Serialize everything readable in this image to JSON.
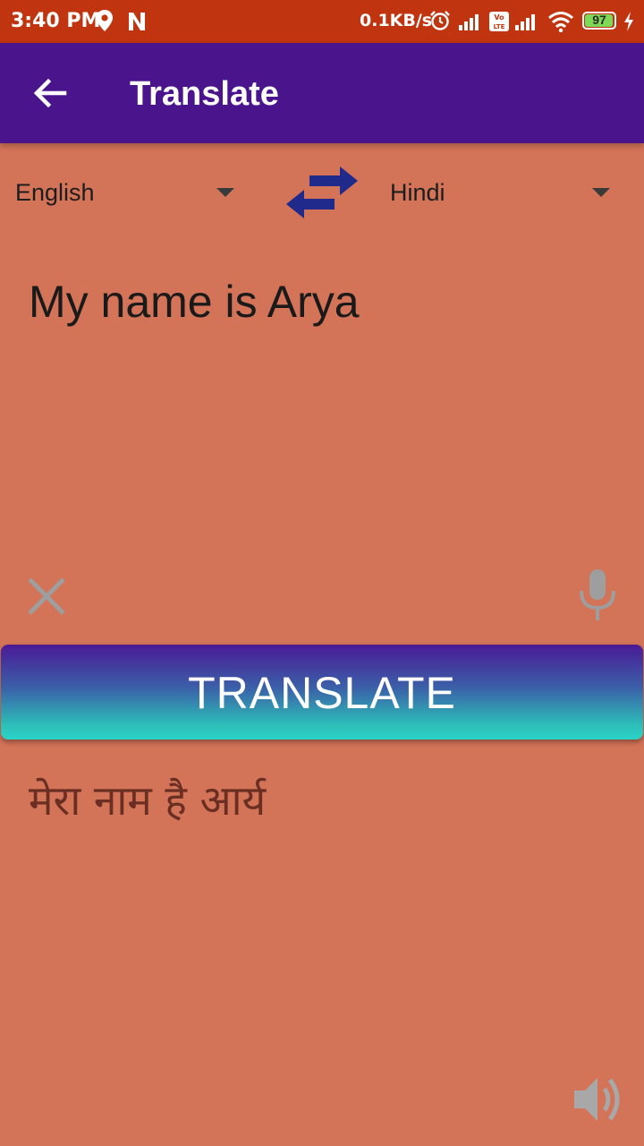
{
  "status_bar": {
    "time": "3:40 PM",
    "network_speed": "0.1KB/s",
    "battery_level": "97",
    "battery_fraction": 0.97,
    "icons": [
      "location-icon",
      "notification-n-icon",
      "alarm-icon",
      "signal-icon",
      "volte-icon",
      "signal-icon",
      "wifi-icon",
      "battery-icon",
      "charging-icon"
    ]
  },
  "app_bar": {
    "title": "Translate",
    "back_icon": "arrow-back-icon"
  },
  "languages": {
    "source": "English",
    "target": "Hindi",
    "swap_icon": "swap-arrows-icon"
  },
  "input": {
    "text": "My name is Arya",
    "clear_icon": "close-icon",
    "mic_icon": "microphone-icon"
  },
  "action": {
    "translate_label": "TRANSLATE"
  },
  "output": {
    "text": "मेरा नाम है आर्य",
    "speaker_icon": "speaker-icon"
  },
  "colors": {
    "status_bar": "#c0350f",
    "app_bar": "#4a148c",
    "background": "#d37358",
    "swap_icon": "#1a237e",
    "button_gradient_top": "#4a1a95",
    "button_gradient_bottom": "#2bd3c6"
  }
}
